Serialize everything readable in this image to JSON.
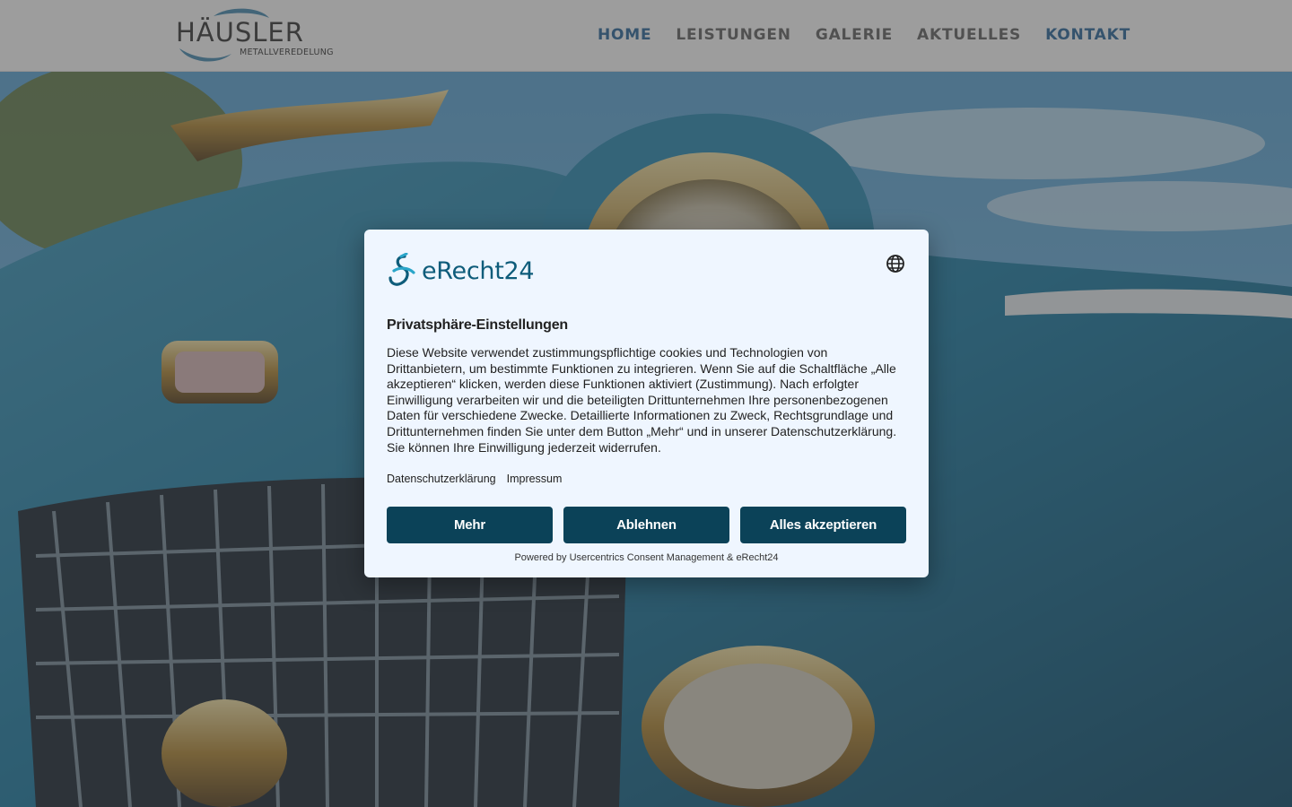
{
  "header": {
    "logo": {
      "name": "HÄUSLER",
      "sub": "METALLVEREDELUNG"
    },
    "nav": [
      {
        "label": "HOME",
        "active": true
      },
      {
        "label": "LEISTUNGEN",
        "active": false
      },
      {
        "label": "GALERIE",
        "active": false
      },
      {
        "label": "AKTUELLES",
        "active": false
      },
      {
        "label": "KONTAKT",
        "active": true
      }
    ]
  },
  "consent": {
    "brand": "eRecht24",
    "title": "Privatsphäre-Einstellungen",
    "body": "Diese Website verwendet zustimmungspflichtige cookies und Technologien von Drittanbietern, um bestimmte Funktionen zu integrieren. Wenn Sie auf die Schaltfläche „Alle akzeptieren“ klicken, werden diese Funktionen aktiviert (Zustimmung). Nach erfolgter Einwilligung verarbeiten wir und die beteiligten Drittunternehmen Ihre personenbezogenen Daten für verschiedene Zwecke. Detaillierte Informationen zu Zweck, Rechtsgrundlage und Drittunternehmen finden Sie unter dem Button „Mehr“ und in unserer Datenschutzerklärung. Sie können Ihre Einwilligung jederzeit widerrufen.",
    "links": {
      "privacy": "Datenschutzerklärung",
      "imprint": "Impressum"
    },
    "buttons": {
      "more": "Mehr",
      "decline": "Ablehnen",
      "accept_all": "Alles akzeptieren"
    },
    "powered_by": "Powered by Usercentrics Consent Management & eRecht24"
  },
  "colors": {
    "nav_active": "#2e6a9e",
    "nav_inactive": "#666666",
    "button_bg": "#0b4258",
    "dialog_bg": "#eff6ff",
    "brand": "#0e5c7a"
  },
  "icons": {
    "language": "globe-icon",
    "brand_mark": "erecht24-logo-icon",
    "logo_swoosh": "haeusler-swoosh-icon"
  }
}
